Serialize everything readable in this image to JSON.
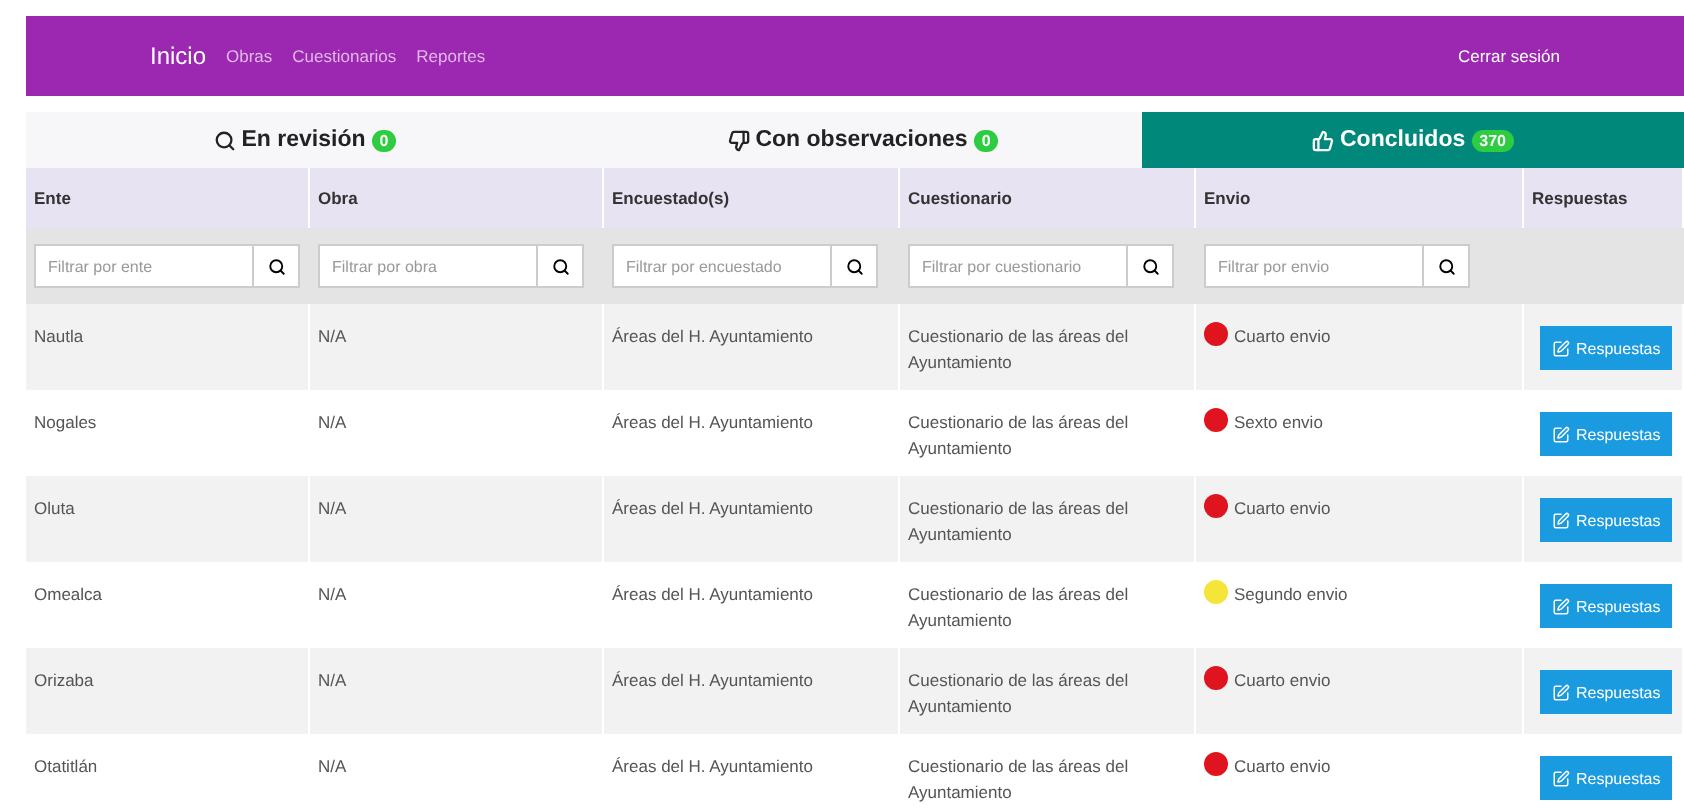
{
  "navbar": {
    "brand": "Inicio",
    "links": [
      "Obras",
      "Cuestionarios",
      "Reportes"
    ],
    "logout": "Cerrar sesión"
  },
  "tabs": [
    {
      "label": "En revisión",
      "count": "0",
      "selected": false
    },
    {
      "label": "Con observaciones",
      "count": "0",
      "selected": false
    },
    {
      "label": "Concluidos",
      "count": "370",
      "selected": true
    }
  ],
  "table": {
    "columns": [
      "Ente",
      "Obra",
      "Encuestado(s)",
      "Cuestionario",
      "Envio",
      "Respuestas"
    ],
    "filters": [
      {
        "placeholder": "Filtrar por ente"
      },
      {
        "placeholder": "Filtrar por obra"
      },
      {
        "placeholder": "Filtrar por encuestado"
      },
      {
        "placeholder": "Filtrar por cuestionario"
      },
      {
        "placeholder": "Filtrar por envio"
      }
    ],
    "rows": [
      {
        "ente": "Nautla",
        "obra": "N/A",
        "encuestado": "Áreas del H. Ayuntamiento",
        "cuestionario": "Cuestionario de las áreas del Ayuntamiento",
        "envio": "Cuarto envio",
        "color": "#e0141e",
        "action": "Respuestas"
      },
      {
        "ente": "Nogales",
        "obra": "N/A",
        "encuestado": "Áreas del H. Ayuntamiento",
        "cuestionario": "Cuestionario de las áreas del Ayuntamiento",
        "envio": "Sexto envio",
        "color": "#e0141e",
        "action": "Respuestas"
      },
      {
        "ente": "Oluta",
        "obra": "N/A",
        "encuestado": "Áreas del H. Ayuntamiento",
        "cuestionario": "Cuestionario de las áreas del Ayuntamiento",
        "envio": "Cuarto envio",
        "color": "#e0141e",
        "action": "Respuestas"
      },
      {
        "ente": "Omealca",
        "obra": "N/A",
        "encuestado": "Áreas del H. Ayuntamiento",
        "cuestionario": "Cuestionario de las áreas del Ayuntamiento",
        "envio": "Segundo envio",
        "color": "#f5e43a",
        "action": "Respuestas"
      },
      {
        "ente": "Orizaba",
        "obra": "N/A",
        "encuestado": "Áreas del H. Ayuntamiento",
        "cuestionario": "Cuestionario de las áreas del Ayuntamiento",
        "envio": "Cuarto envio",
        "color": "#e0141e",
        "action": "Respuestas"
      },
      {
        "ente": "Otatitlán",
        "obra": "N/A",
        "encuestado": "Áreas del H. Ayuntamiento",
        "cuestionario": "Cuestionario de las áreas del Ayuntamiento",
        "envio": "Cuarto envio",
        "color": "#e0141e",
        "action": "Respuestas"
      }
    ]
  }
}
